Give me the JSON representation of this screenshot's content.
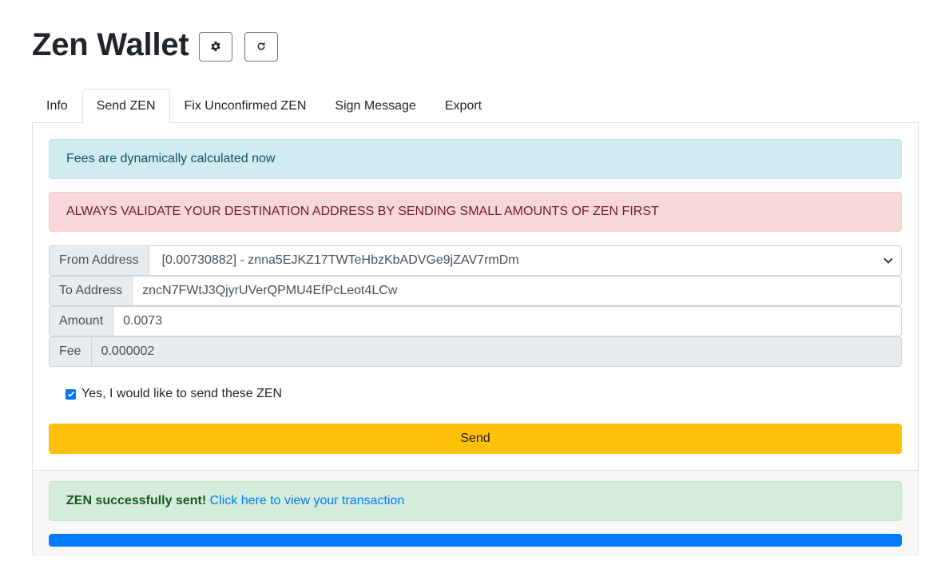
{
  "header": {
    "title": "Zen Wallet",
    "settings_icon": "gear-icon",
    "refresh_icon": "refresh-icon"
  },
  "tabs": [
    {
      "label": "Info",
      "active": false
    },
    {
      "label": "Send ZEN",
      "active": true
    },
    {
      "label": "Fix Unconfirmed ZEN",
      "active": false
    },
    {
      "label": "Sign Message",
      "active": false
    },
    {
      "label": "Export",
      "active": false
    }
  ],
  "alerts": {
    "info": "Fees are dynamically calculated now",
    "warning": "ALWAYS VALIDATE YOUR DESTINATION ADDRESS BY SENDING SMALL AMOUNTS OF ZEN FIRST"
  },
  "form": {
    "from_label": "From Address",
    "from_value": "[0.00730882] - znna5EJKZ17TWTeHbzKbADVGe9jZAV7rmDm",
    "to_label": "To Address",
    "to_value": "zncN7FWtJ3QjyrUVerQPMU4EfPcLeot4LCw",
    "amount_label": "Amount",
    "amount_value": "0.0073",
    "fee_label": "Fee",
    "fee_value": "0.000002",
    "confirm_label": "Yes, I would like to send these ZEN",
    "confirm_checked": true,
    "send_label": "Send"
  },
  "result": {
    "success_strong": "ZEN successfully sent!",
    "link_text": "Click here to view your transaction",
    "progress_fraction": 1.0
  },
  "colors": {
    "send_button": "#ffc107",
    "progress": "#007bff",
    "link": "#007bff"
  }
}
